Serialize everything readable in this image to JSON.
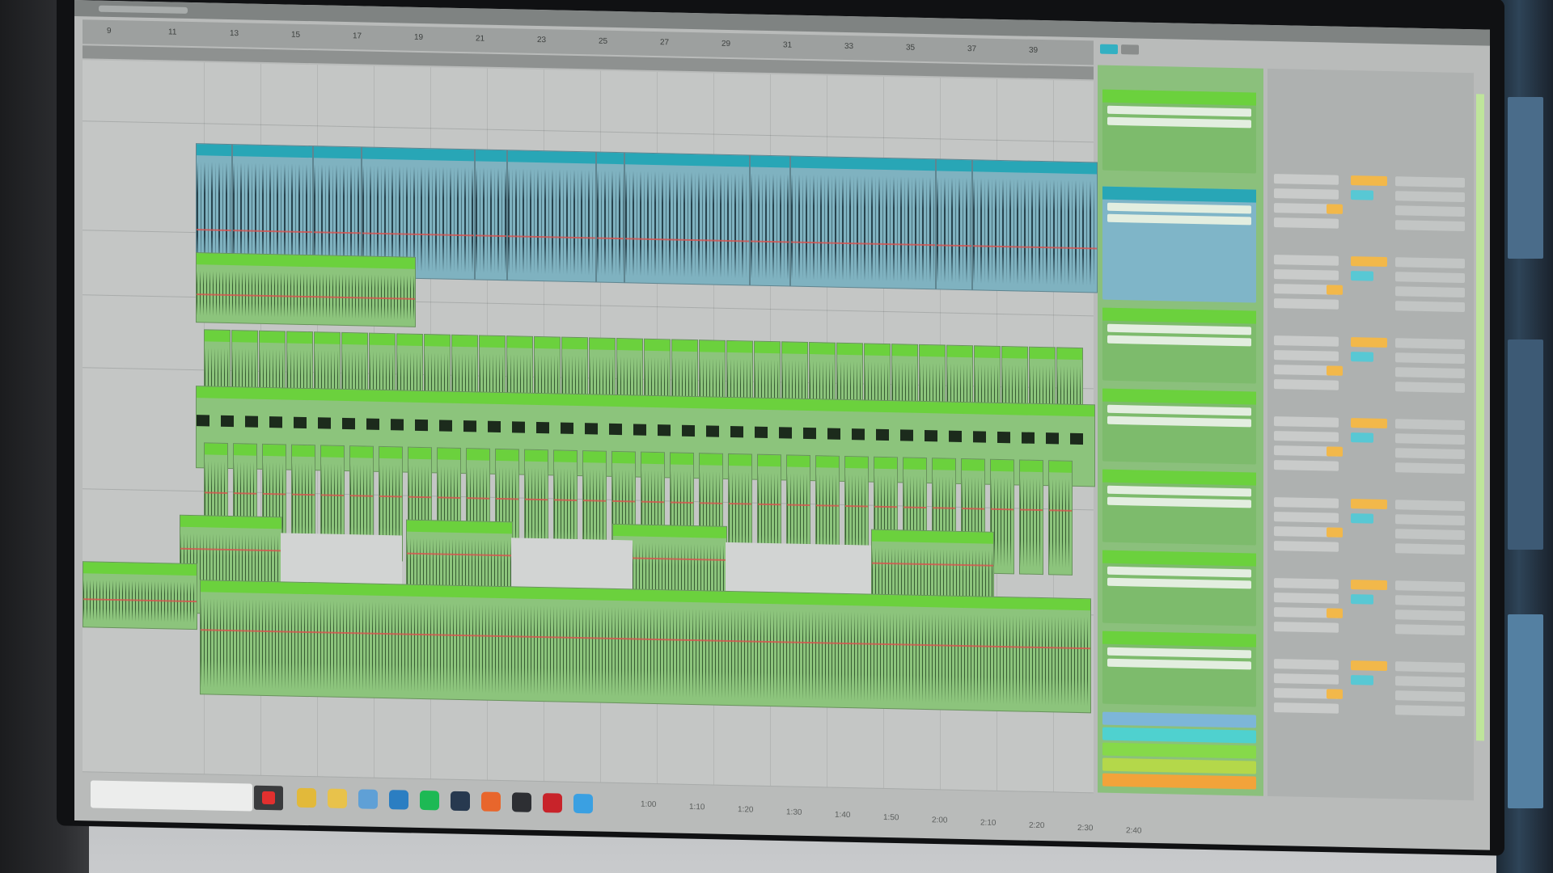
{
  "window": {
    "title": ""
  },
  "ruler": {
    "ticks": [
      "9",
      "11",
      "13",
      "15",
      "17",
      "19",
      "21",
      "23",
      "25",
      "27",
      "29",
      "31",
      "33",
      "35",
      "37",
      "39"
    ]
  },
  "session_tabs": [
    {
      "active": true
    },
    {
      "active": false
    }
  ],
  "tracks": [
    {
      "name": "",
      "color": "#28a6b6",
      "type": "audio"
    },
    {
      "name": "",
      "color": "#6bd13d",
      "type": "audio"
    },
    {
      "name": "",
      "color": "#6bd13d",
      "type": "drums"
    },
    {
      "name": "",
      "color": "#6bd13d",
      "type": "midi"
    },
    {
      "name": "",
      "color": "#6bd13d",
      "type": "audio"
    },
    {
      "name": "",
      "color": "#6bd13d",
      "type": "audio"
    }
  ],
  "session_slots": [
    {
      "label": "",
      "color": "#6bd13d"
    },
    {
      "label": "",
      "color": "#28a6b6"
    },
    {
      "label": "",
      "color": "#6bd13d"
    },
    {
      "label": "",
      "color": "#6bd13d"
    },
    {
      "label": "",
      "color": "#6bd13d"
    },
    {
      "label": "",
      "color": "#6bd13d"
    },
    {
      "label": "",
      "color": "#6bd13d"
    },
    {
      "label": "",
      "color": "#6bd13d"
    }
  ],
  "return_swatches": [
    "#7db6d8",
    "#4fd1cf",
    "#86d94a",
    "#b4d84a",
    "#f2a33a"
  ],
  "mixer_chip_colors": {
    "solo": "#f2b84a",
    "arm": "#58c8d4"
  },
  "taskbar": {
    "search_placeholder": "",
    "apps": [
      {
        "icon": "chrome-icon",
        "color": "#e2b93a"
      },
      {
        "icon": "folder-icon",
        "color": "#e8c24b"
      },
      {
        "icon": "app-icon",
        "color": "#5fa0d6"
      },
      {
        "icon": "photos-icon",
        "color": "#2b7ec2"
      },
      {
        "icon": "spotify-icon",
        "color": "#1db954"
      },
      {
        "icon": "steam-icon",
        "color": "#27394f"
      },
      {
        "icon": "teams-icon",
        "color": "#e8662c"
      },
      {
        "icon": "terminal-icon",
        "color": "#2d2f33"
      },
      {
        "icon": "record-app-icon",
        "color": "#c8232a"
      },
      {
        "icon": "browser-icon",
        "color": "#3aa0e2"
      }
    ]
  },
  "timeline_ticks": [
    "1:00",
    "1:10",
    "1:20",
    "1:30",
    "1:40",
    "1:50",
    "2:00",
    "2:10",
    "2:20",
    "2:30",
    "2:40"
  ]
}
